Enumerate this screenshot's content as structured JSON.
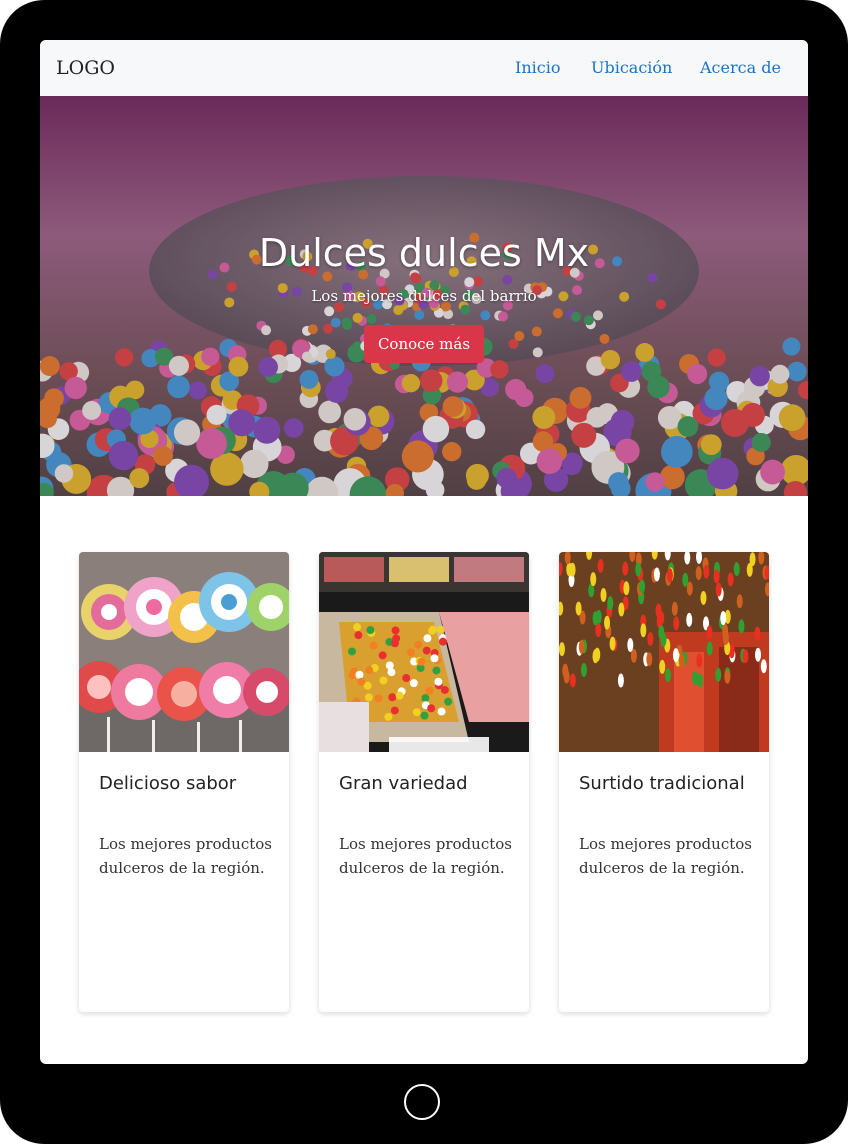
{
  "nav": {
    "logo": "LOGO",
    "links": [
      {
        "label": "Inicio"
      },
      {
        "label": "Ubicación"
      },
      {
        "label": "Acerca de"
      }
    ]
  },
  "hero": {
    "title": "Dulces dulces Mx",
    "subtitle": "Los mejores dulces del barrio",
    "button_label": "Conoce más"
  },
  "cards": [
    {
      "title": "Delicioso sabor",
      "text": "Los mejores productos dulceros de la región."
    },
    {
      "title": "Gran variedad",
      "text": "Los mejores productos dulceros de la región."
    },
    {
      "title": "Surtido tradicional",
      "text": "Los mejores productos dulceros de la región."
    }
  ],
  "colors": {
    "link": "#1a73c9",
    "button": "#d9364a",
    "navbar_bg": "#f7f8f9"
  }
}
